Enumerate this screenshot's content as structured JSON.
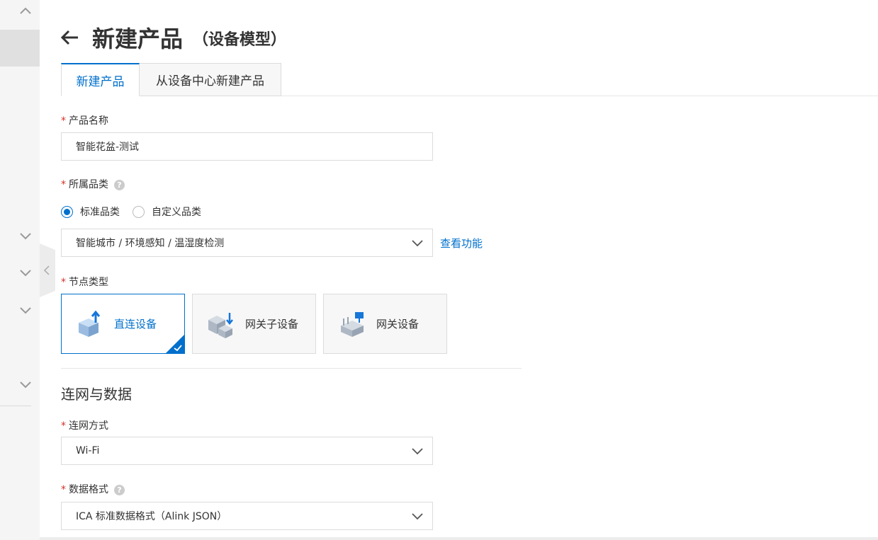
{
  "sidebar": {
    "icons": [
      "chevron-up-icon",
      "chevron-down-icon",
      "chevron-down-icon",
      "chevron-down-icon",
      "chevron-down-icon",
      "chevron-left-icon"
    ]
  },
  "header": {
    "title": "新建产品",
    "subtitle": "（设备模型）",
    "back_icon": "arrow-left-icon"
  },
  "tabs": [
    {
      "label": "新建产品",
      "active": true
    },
    {
      "label": "从设备中心新建产品",
      "active": false
    }
  ],
  "form": {
    "product_name": {
      "label": "产品名称",
      "value": "智能花盆-测试"
    },
    "category": {
      "label": "所属品类",
      "options": [
        "标准品类",
        "自定义品类"
      ],
      "selected": "标准品类",
      "value": "智能城市 / 环境感知 / 温湿度检测",
      "link": "查看功能"
    },
    "node_type": {
      "label": "节点类型",
      "options": [
        "直连设备",
        "网关子设备",
        "网关设备"
      ],
      "selected": "直连设备"
    }
  },
  "network_section": {
    "title": "连网与数据",
    "connection": {
      "label": "连网方式",
      "value": "Wi-Fi"
    },
    "data_format": {
      "label": "数据格式",
      "value": "ICA 标准数据格式（Alink JSON）"
    }
  },
  "colors": {
    "accent": "#0070cc",
    "required": "#d93026"
  }
}
